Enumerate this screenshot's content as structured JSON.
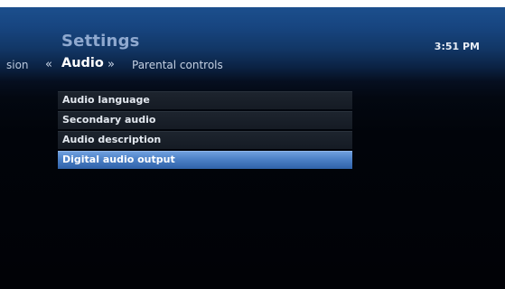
{
  "header": {
    "title": "Settings",
    "clock": "3:51 PM"
  },
  "tabs": {
    "previous": "sion",
    "current": "Audio",
    "next": "Parental controls",
    "left_chevron": "«",
    "right_chevron": "»"
  },
  "menu": {
    "items": [
      {
        "label": "Audio language",
        "selected": false
      },
      {
        "label": "Secondary audio",
        "selected": false
      },
      {
        "label": "Audio description",
        "selected": false
      },
      {
        "label": "Digital audio output",
        "selected": true
      }
    ]
  },
  "colors": {
    "header_blue": "#1c4f8d",
    "selected_highlight": "#4c80c6",
    "background": "#010206"
  }
}
